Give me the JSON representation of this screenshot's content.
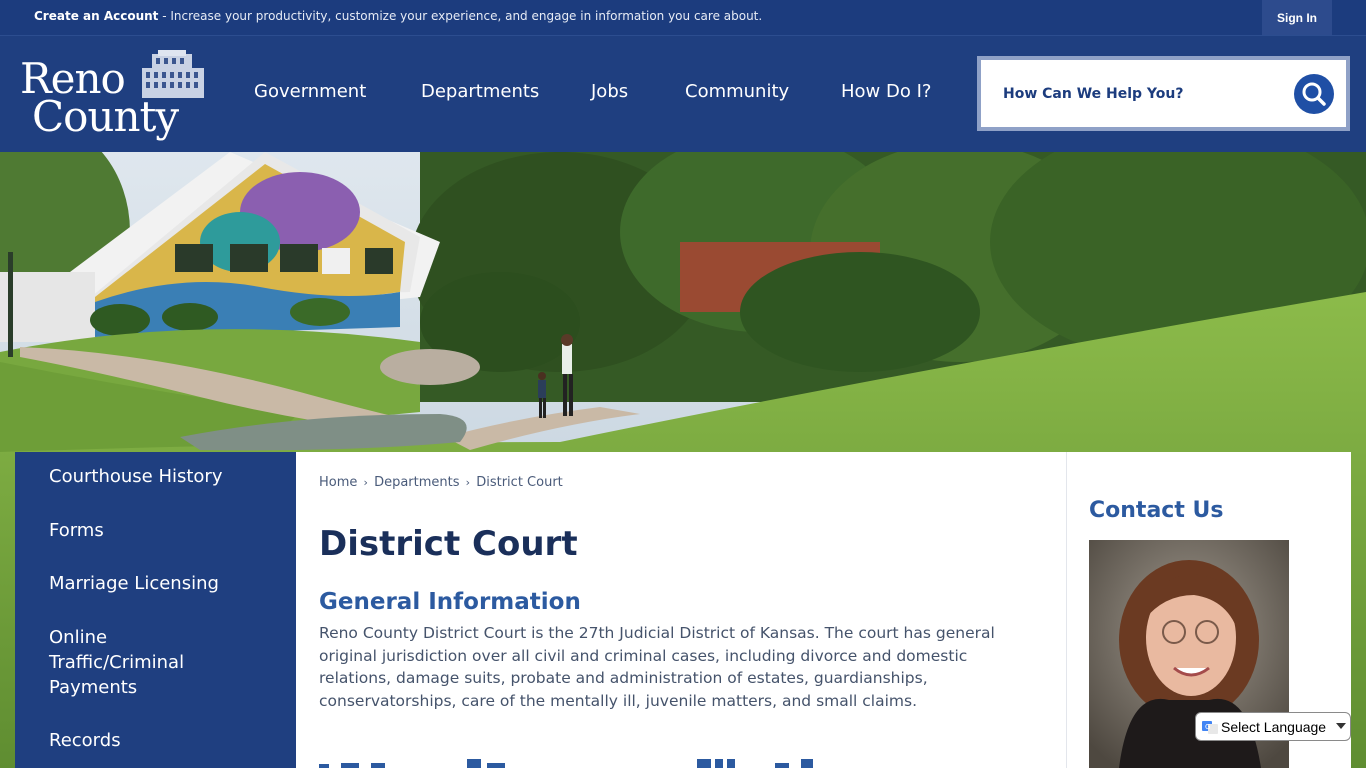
{
  "topbar": {
    "create_account_label": "Create an Account",
    "message": " - Increase your productivity, customize your experience, and engage in information you care about.",
    "sign_in_label": "Sign In"
  },
  "logo": {
    "line1": "Reno",
    "line2": "County"
  },
  "nav": {
    "items": [
      {
        "label": "Government"
      },
      {
        "label": "Departments"
      },
      {
        "label": "Jobs"
      },
      {
        "label": "Community"
      },
      {
        "label": "How Do I?"
      }
    ]
  },
  "search": {
    "placeholder": "How Can We Help You?",
    "icon": "search-icon"
  },
  "sidebar": {
    "items": [
      {
        "label": "Courthouse History"
      },
      {
        "label": "Forms"
      },
      {
        "label": "Marriage Licensing"
      },
      {
        "label": "Online Traffic/Criminal Payments"
      },
      {
        "label": "Records"
      }
    ]
  },
  "breadcrumb": {
    "home": "Home",
    "departments": "Departments",
    "current": "District Court",
    "separator": "›"
  },
  "main": {
    "title": "District Court",
    "section_title": "General Information",
    "body": "Reno County District Court is the 27th Judicial District of Kansas. The court has general original jurisdiction over all civil and criminal cases, including divorce and domestic relations, damage suits, probate and administration of estates, guardianships, conservatorships, care of the mentally ill, juvenile matters, and small claims."
  },
  "right_panel": {
    "title": "Contact Us"
  },
  "language": {
    "label": "Select Language"
  },
  "colors": {
    "brand_navy": "#1f3f80",
    "heading_blue": "#2c5aa0",
    "title_dark": "#1a2f5a"
  }
}
